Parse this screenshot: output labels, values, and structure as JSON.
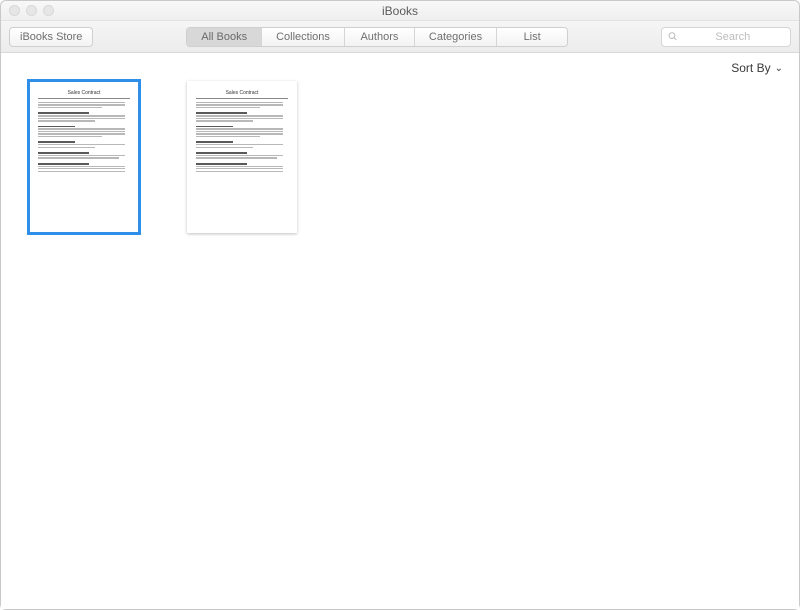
{
  "window": {
    "title": "iBooks"
  },
  "toolbar": {
    "store_label": "iBooks Store",
    "tabs": [
      {
        "label": "All Books",
        "active": true
      },
      {
        "label": "Collections",
        "active": false
      },
      {
        "label": "Authors",
        "active": false
      },
      {
        "label": "Categories",
        "active": false
      },
      {
        "label": "List",
        "active": false
      }
    ],
    "search_placeholder": "Search"
  },
  "content": {
    "sort_label": "Sort By",
    "books": [
      {
        "title": "Sales Contract",
        "selected": true
      },
      {
        "title": "Sales Contract",
        "selected": false
      }
    ]
  }
}
